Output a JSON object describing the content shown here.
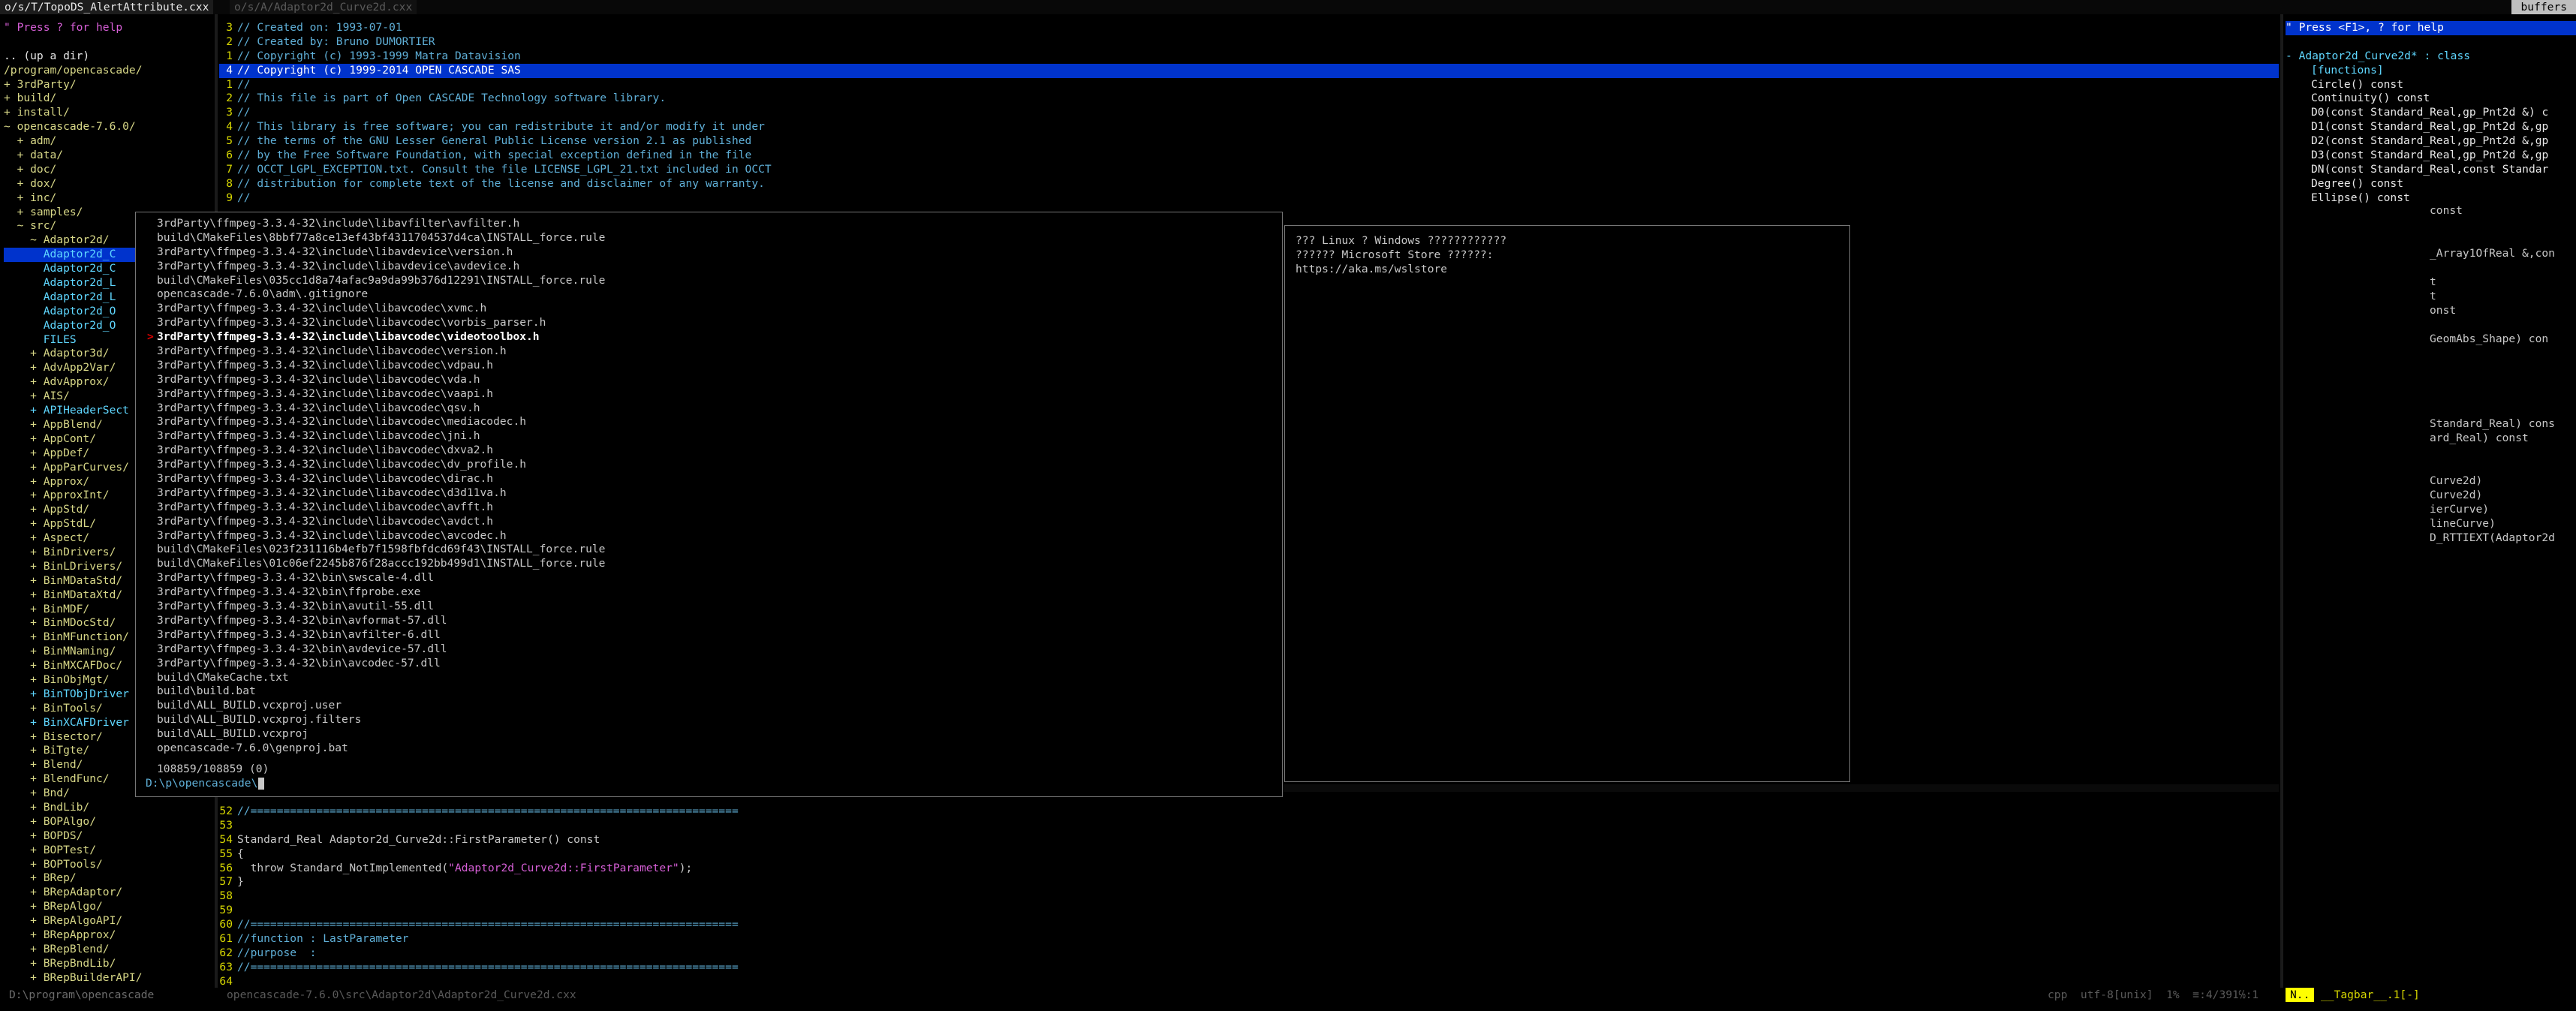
{
  "tabs": {
    "left": "o/s/T/TopoDS_AlertAttribute.cxx",
    "right": "o/s/A/Adaptor2d_Curve2d.cxx",
    "buffers": "buffers"
  },
  "tree": {
    "help": "\" Press ? for help",
    "updir": ".. (up a dir)",
    "root": "/program/opencascade/",
    "items": [
      "+ 3rdParty/",
      "+ build/",
      "+ install/",
      "~ opencascade-7.6.0/",
      "  + adm/",
      "  + data/",
      "  + doc/",
      "  + dox/",
      "  + inc/",
      "  + samples/",
      "  ~ src/",
      "    ~ Adaptor2d/",
      "      Adaptor2d_C",
      "      Adaptor2d_C",
      "      Adaptor2d_L",
      "      Adaptor2d_L",
      "      Adaptor2d_O",
      "      Adaptor2d_O",
      "      FILES",
      "    + Adaptor3d/",
      "    + AdvApp2Var/",
      "    + AdvApprox/",
      "    + AIS/",
      "    + APIHeaderSect",
      "    + AppBlend/",
      "    + AppCont/",
      "    + AppDef/",
      "    + AppParCurves/",
      "    + Approx/",
      "    + ApproxInt/",
      "    + AppStd/",
      "    + AppStdL/",
      "    + Aspect/",
      "    + BinDrivers/",
      "    + BinLDrivers/",
      "    + BinMDataStd/",
      "    + BinMDataXtd/",
      "    + BinMDF/",
      "    + BinMDocStd/",
      "    + BinMFunction/",
      "    + BinMNaming/",
      "    + BinMXCAFDoc/",
      "    + BinObjMgt/",
      "    + BinTObjDriver",
      "    + BinTools/",
      "    + BinXCAFDriver",
      "    + Bisector/",
      "    + BiTgte/",
      "    + Blend/",
      "    + BlendFunc/",
      "    + Bnd/",
      "    + BndLib/",
      "    + BOPAlgo/",
      "    + BOPDS/",
      "    + BOPTest/",
      "    + BOPTools/",
      "    + BRep/",
      "    + BRepAdaptor/",
      "    + BRepAlgo/",
      "    + BRepAlgoAPI/",
      "    + BRepApprox/",
      "    + BRepBlend/",
      "    + BRepBndLib/",
      "    + BRepBuilderAPI/"
    ]
  },
  "editor_top": {
    "lines": [
      {
        "n": "3",
        "t": "// Created on: 1993-07-01"
      },
      {
        "n": "2",
        "t": "// Created by: Bruno DUMORTIER"
      },
      {
        "n": "1",
        "t": "// Copyright (c) 1993-1999 Matra Datavision"
      },
      {
        "n": "4",
        "t": "// Copyright (c) 1999-2014 OPEN CASCADE SAS"
      },
      {
        "n": "1",
        "t": "//"
      },
      {
        "n": "2",
        "t": "// This file is part of Open CASCADE Technology software library."
      },
      {
        "n": "3",
        "t": "//"
      },
      {
        "n": "4",
        "t": "// This library is free software; you can redistribute it and/or modify it under"
      },
      {
        "n": "5",
        "t": "// the terms of the GNU Lesser General Public License version 2.1 as published"
      },
      {
        "n": "6",
        "t": "// by the Free Software Foundation, with special exception defined in the file"
      },
      {
        "n": "7",
        "t": "// OCCT_LGPL_EXCEPTION.txt. Consult the file LICENSE_LGPL_21.txt included in OCCT"
      },
      {
        "n": "8",
        "t": "// distribution for complete text of the license and disclaimer of any warranty."
      },
      {
        "n": "9",
        "t": "//"
      }
    ]
  },
  "editor_bottom": {
    "lines": [
      {
        "n": "52",
        "t": "//=========================================================================="
      },
      {
        "n": "53",
        "t": ""
      },
      {
        "n": "54",
        "t": "Standard_Real Adaptor2d_Curve2d::FirstParameter() const"
      },
      {
        "n": "55",
        "t": "{"
      },
      {
        "n": "56",
        "a": "  throw Standard_NotImplemented(",
        "s": "\"Adaptor2d_Curve2d::FirstParameter\"",
        "b": ");"
      },
      {
        "n": "57",
        "t": "}"
      },
      {
        "n": "58",
        "t": ""
      },
      {
        "n": "59",
        "t": ""
      },
      {
        "n": "60",
        "t": "//=========================================================================="
      },
      {
        "n": "61",
        "t": "//function : LastParameter"
      },
      {
        "n": "62",
        "t": "//purpose  :"
      },
      {
        "n": "63",
        "t": "//=========================================================================="
      },
      {
        "n": "64",
        "t": ""
      }
    ]
  },
  "tagbar": {
    "help": "\" Press <F1>, ? for help",
    "cls": "- Adaptor2d_Curve2d* : class",
    "group": "[functions]",
    "items": [
      "Circle() const",
      "Continuity() const",
      "D0(const Standard_Real,gp_Pnt2d &) c",
      "D1(const Standard_Real,gp_Pnt2d &,gp",
      "D2(const Standard_Real,gp_Pnt2d &,gp",
      "D3(const Standard_Real,gp_Pnt2d &,gp",
      "DN(const Standard_Real,const Standar",
      "Degree() const",
      "Ellipse() const"
    ],
    "fragments": [
      "const",
      "_Array1OfReal &,con",
      "t",
      "t",
      "onst",
      "GeomAbs_Shape) con",
      "Standard_Real) cons",
      "ard_Real) const",
      "Curve2d)",
      "Curve2d)",
      "ierCurve)",
      "lineCurve)",
      "D_RTTIEXT(Adaptor2d"
    ]
  },
  "finder": {
    "results": [
      "3rdParty\\ffmpeg-3.3.4-32\\include\\libavfilter\\avfilter.h",
      "build\\CMakeFiles\\8bbf77a8ce13ef43bf4311704537d4ca\\INSTALL_force.rule",
      "3rdParty\\ffmpeg-3.3.4-32\\include\\libavdevice\\version.h",
      "3rdParty\\ffmpeg-3.3.4-32\\include\\libavdevice\\avdevice.h",
      "build\\CMakeFiles\\035cc1d8a74afac9a9da99b376d12291\\INSTALL_force.rule",
      "opencascade-7.6.0\\adm\\.gitignore",
      "3rdParty\\ffmpeg-3.3.4-32\\include\\libavcodec\\xvmc.h",
      "3rdParty\\ffmpeg-3.3.4-32\\include\\libavcodec\\vorbis_parser.h",
      "3rdParty\\ffmpeg-3.3.4-32\\include\\libavcodec\\videotoolbox.h",
      "3rdParty\\ffmpeg-3.3.4-32\\include\\libavcodec\\version.h",
      "3rdParty\\ffmpeg-3.3.4-32\\include\\libavcodec\\vdpau.h",
      "3rdParty\\ffmpeg-3.3.4-32\\include\\libavcodec\\vda.h",
      "3rdParty\\ffmpeg-3.3.4-32\\include\\libavcodec\\vaapi.h",
      "3rdParty\\ffmpeg-3.3.4-32\\include\\libavcodec\\qsv.h",
      "3rdParty\\ffmpeg-3.3.4-32\\include\\libavcodec\\mediacodec.h",
      "3rdParty\\ffmpeg-3.3.4-32\\include\\libavcodec\\jni.h",
      "3rdParty\\ffmpeg-3.3.4-32\\include\\libavcodec\\dxva2.h",
      "3rdParty\\ffmpeg-3.3.4-32\\include\\libavcodec\\dv_profile.h",
      "3rdParty\\ffmpeg-3.3.4-32\\include\\libavcodec\\dirac.h",
      "3rdParty\\ffmpeg-3.3.4-32\\include\\libavcodec\\d3d11va.h",
      "3rdParty\\ffmpeg-3.3.4-32\\include\\libavcodec\\avfft.h",
      "3rdParty\\ffmpeg-3.3.4-32\\include\\libavcodec\\avdct.h",
      "3rdParty\\ffmpeg-3.3.4-32\\include\\libavcodec\\avcodec.h",
      "build\\CMakeFiles\\023f231116b4efb7f1598fbfdcd69f43\\INSTALL_force.rule",
      "build\\CMakeFiles\\01c06ef2245b876f28accc192bb499d1\\INSTALL_force.rule",
      "3rdParty\\ffmpeg-3.3.4-32\\bin\\swscale-4.dll",
      "3rdParty\\ffmpeg-3.3.4-32\\bin\\ffprobe.exe",
      "3rdParty\\ffmpeg-3.3.4-32\\bin\\avutil-55.dll",
      "3rdParty\\ffmpeg-3.3.4-32\\bin\\avformat-57.dll",
      "3rdParty\\ffmpeg-3.3.4-32\\bin\\avfilter-6.dll",
      "3rdParty\\ffmpeg-3.3.4-32\\bin\\avdevice-57.dll",
      "3rdParty\\ffmpeg-3.3.4-32\\bin\\avcodec-57.dll",
      "build\\CMakeCache.txt",
      "build\\build.bat",
      "build\\ALL_BUILD.vcxproj.user",
      "build\\ALL_BUILD.vcxproj.filters",
      "build\\ALL_BUILD.vcxproj",
      "opencascade-7.6.0\\genproj.bat"
    ],
    "selected_index": 8,
    "marker": ">",
    "count": "108859/108859 (0)",
    "prompt": "D:\\p\\opencascade\\"
  },
  "preview": {
    "lines": [
      "??? Linux ? Windows ????????????",
      "?????? Microsoft Store ??????:",
      "https://aka.ms/wslstore"
    ]
  },
  "status": {
    "left": "D:\\program\\opencascade",
    "middle": "opencascade-7.6.0\\src\\Adaptor2d\\Adaptor2d_Curve2d.cxx",
    "right": "cpp  utf-8[unix]  1%  ≡:4/391℅:1",
    "mode": "N..",
    "tagbar": "__Tagbar__.1[-]"
  },
  "colors": {
    "selection": "#0033cc",
    "mode_badge": "#ffff00",
    "line_number": "#d7d700",
    "comment": "#5fafd7",
    "string": "#d75fd7"
  }
}
